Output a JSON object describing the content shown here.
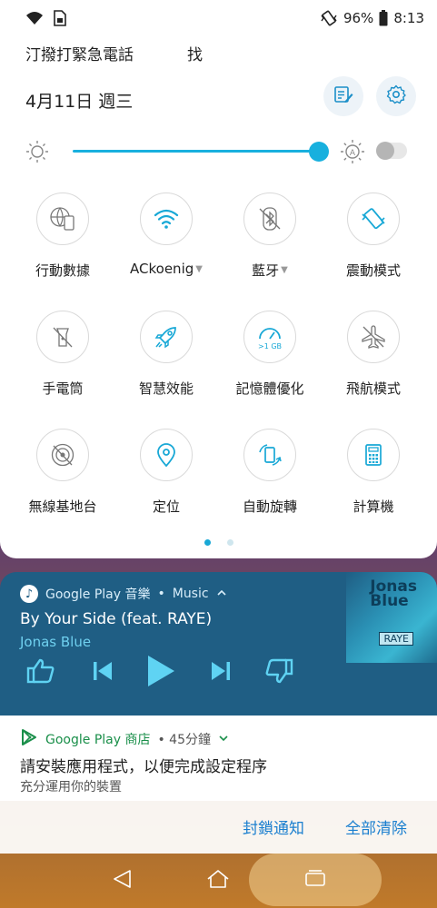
{
  "status_bar": {
    "battery": "96%",
    "time": "8:13",
    "icons": [
      "wifi-icon",
      "sim-card-icon",
      "vibrate-icon",
      "battery-icon"
    ]
  },
  "quick_settings": {
    "emergency": "汀撥打緊急電話",
    "search": "找",
    "date": "4月11日 週三",
    "brightness_level": 0.96,
    "auto_brightness": false,
    "tiles": [
      {
        "label": "行動數據",
        "icon": "mobile-data-icon",
        "caret": false
      },
      {
        "label": "ACkoenig",
        "icon": "wifi-icon",
        "caret": true
      },
      {
        "label": "藍牙",
        "icon": "bluetooth-icon",
        "caret": true
      },
      {
        "label": "震動模式",
        "icon": "vibrate-icon",
        "caret": false
      },
      {
        "label": "手電筒",
        "icon": "flashlight-icon",
        "caret": false
      },
      {
        "label": "智慧效能",
        "icon": "rocket-icon",
        "caret": false
      },
      {
        "label": "記憶體優化",
        "icon": "memory-gauge-icon",
        "caret": false,
        "badge": ">1 GB"
      },
      {
        "label": "飛航模式",
        "icon": "airplane-icon",
        "caret": false
      },
      {
        "label": "無線基地台",
        "icon": "hotspot-icon",
        "caret": false
      },
      {
        "label": "定位",
        "icon": "location-icon",
        "caret": false
      },
      {
        "label": "自動旋轉",
        "icon": "auto-rotate-icon",
        "caret": false
      },
      {
        "label": "計算機",
        "icon": "calculator-icon",
        "caret": false
      }
    ],
    "page_count": 2,
    "active_page": 1
  },
  "music_notification": {
    "app_name": "Google Play 音樂",
    "separator": "•",
    "category": "Music",
    "title": "By Your Side (feat. RAYE)",
    "artist": "Jonas Blue",
    "art_text_1": "Jonas",
    "art_text_2": "Blue",
    "art_badge": "RAYE",
    "colors": {
      "background": "#1f5e84",
      "accent": "#6fd0ef"
    }
  },
  "store_notification": {
    "app_name": "Google Play 商店",
    "meta": "• 45分鐘",
    "title": "請安裝應用程式，以便完成設定程序",
    "subtitle": "充分運用你的裝置"
  },
  "actions": {
    "block": "封鎖通知",
    "clear_all": "全部清除"
  },
  "nav": {
    "buttons": [
      "back-icon",
      "home-icon",
      "recents-icon"
    ]
  }
}
